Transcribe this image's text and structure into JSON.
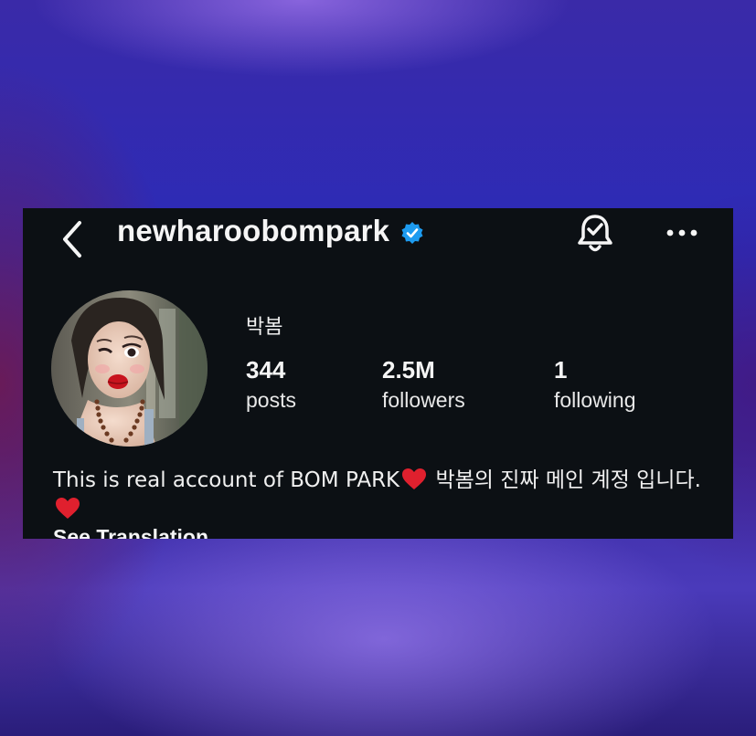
{
  "header": {
    "username": "newharoobompark",
    "back_icon": "chevron-left-icon",
    "verified_icon": "verified-badge-icon",
    "notifications_icon": "bell-check-icon",
    "more_icon": "more-horizontal-icon"
  },
  "profile": {
    "display_name": "박봄",
    "stats": [
      {
        "value": "344",
        "label": "posts"
      },
      {
        "value": "2.5M",
        "label": "followers"
      },
      {
        "value": "1",
        "label": "following"
      }
    ],
    "bio_text_1": "This is real account of BOM PARK",
    "bio_text_2": " 박봄의 진짜 메인 계정 입니다.",
    "bio_emoji": "heart-emoji",
    "see_translation": "See Translation"
  },
  "colors": {
    "card_background": "#0c1014",
    "verified_blue": "#1d9bf0",
    "heart_red": "#e0202e",
    "text": "#f5f5f5"
  }
}
